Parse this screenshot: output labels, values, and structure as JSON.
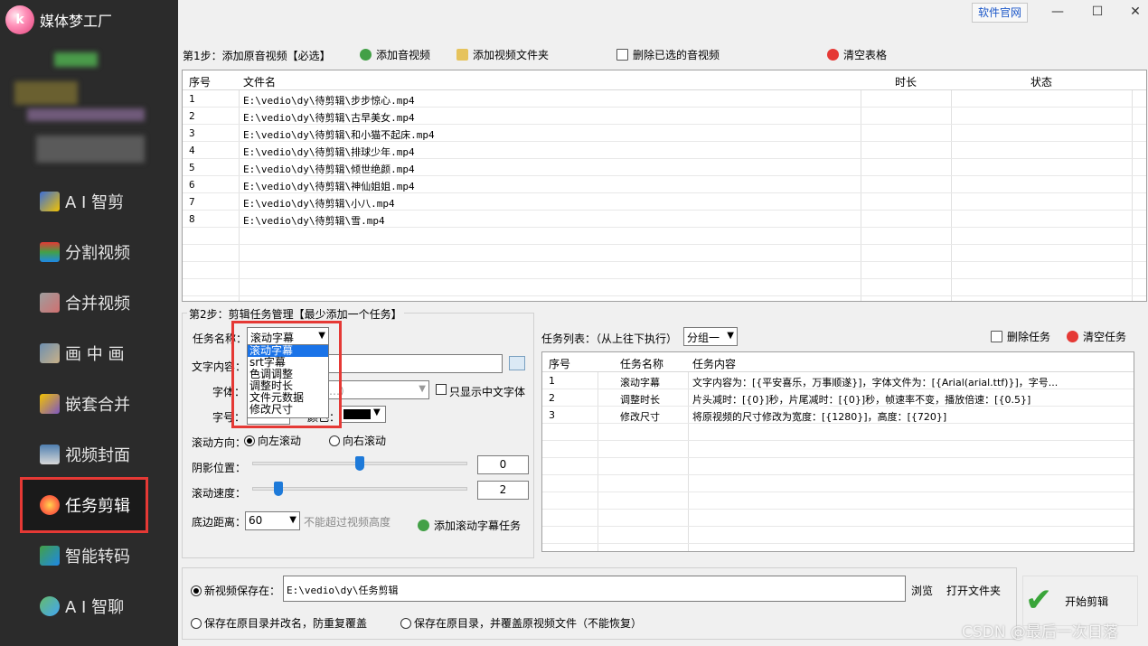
{
  "app": {
    "title": "媒体梦工厂",
    "logo_text": "k"
  },
  "sidebar": {
    "items": [
      {
        "label": "A I 智剪",
        "icon": "ai-cut-icon"
      },
      {
        "label": "分割视频",
        "icon": "split-video-icon"
      },
      {
        "label": "合并视频",
        "icon": "merge-video-icon"
      },
      {
        "label": "画 中 画",
        "icon": "picture-in-picture-icon"
      },
      {
        "label": "嵌套合并",
        "icon": "nested-merge-icon"
      },
      {
        "label": "视频封面",
        "icon": "video-cover-icon"
      },
      {
        "label": "任务剪辑",
        "icon": "task-edit-icon",
        "active": true
      },
      {
        "label": "智能转码",
        "icon": "smart-transcode-icon"
      },
      {
        "label": "A I 智聊",
        "icon": "ai-chat-icon"
      }
    ]
  },
  "topbar": {
    "site_link": "软件官网",
    "minimize": "—",
    "maximize": "☐",
    "close": "✕"
  },
  "step1": {
    "label": "第1步：添加原音视频【必选】",
    "add_av": "添加音视频",
    "add_folder": "添加视频文件夹",
    "delete_selected": "删除已选的音视频",
    "clear_table": "清空表格"
  },
  "file_table": {
    "headers": [
      "序号",
      "文件名",
      "时长",
      "状态"
    ],
    "rows": [
      [
        "1",
        "E:\\vedio\\dy\\待剪辑\\步步惊心.mp4"
      ],
      [
        "2",
        "E:\\vedio\\dy\\待剪辑\\古早美女.mp4"
      ],
      [
        "3",
        "E:\\vedio\\dy\\待剪辑\\和小猫不起床.mp4"
      ],
      [
        "4",
        "E:\\vedio\\dy\\待剪辑\\排球少年.mp4"
      ],
      [
        "5",
        "E:\\vedio\\dy\\待剪辑\\倾世绝颜.mp4"
      ],
      [
        "6",
        "E:\\vedio\\dy\\待剪辑\\神仙姐姐.mp4"
      ],
      [
        "7",
        "E:\\vedio\\dy\\待剪辑\\小八.mp4"
      ],
      [
        "8",
        "E:\\vedio\\dy\\待剪辑\\雪.mp4"
      ]
    ]
  },
  "step2": {
    "label": "第2步：剪辑任务管理【最少添加一个任务】",
    "task_name_label": "任务名称：",
    "task_name_value": "滚动字幕",
    "task_options": [
      "滚动字幕",
      "srt字幕",
      "色调调整",
      "调整时长",
      "文件元数据",
      "修改尺寸"
    ],
    "text_content_label": "文字内容：",
    "font_label": "字体：",
    "font_value": "…）",
    "only_chinese_label": "只显示中文字体",
    "size_label": "字号：",
    "color_label": "颜色：",
    "direction_label": "滚动方向：",
    "dir_left": "向左滚动",
    "dir_right": "向右滚动",
    "shadow_label": "阴影位置：",
    "shadow_value": "0",
    "speed_label": "滚动速度：",
    "speed_value": "2",
    "bottom_label": "底边距离：",
    "bottom_value": "60",
    "bottom_hint": "不能超过视频高度",
    "add_task": "添加滚动字幕任务"
  },
  "task_list": {
    "label": "任务列表：（从上往下执行）",
    "group_value": "分组一",
    "delete_task": "删除任务",
    "clear_tasks": "清空任务",
    "headers": [
      "序号",
      "任务名称",
      "任务内容"
    ],
    "rows": [
      [
        "1",
        "滚动字幕",
        "文字内容为：[{平安喜乐，万事顺遂}]，字体文件为：[{Arial(arial.ttf)}]，字号..."
      ],
      [
        "2",
        "调整时长",
        "片头减时：[{0}]秒，片尾减时：[{0}]秒，帧速率不变，播放倍速：[{0.5}]"
      ],
      [
        "3",
        "修改尺寸",
        "将原视频的尺寸修改为宽度：[{1280}]，高度：[{720}]"
      ]
    ]
  },
  "output": {
    "save_label": "新视频保存在：",
    "save_path": "E:\\vedio\\dy\\任务剪辑",
    "browse": "浏览",
    "open_folder": "打开文件夹",
    "option_rename": "保存在原目录并改名，防重复覆盖",
    "option_overwrite": "保存在原目录，并覆盖原视频文件（不能恢复）",
    "start": "开始剪辑"
  },
  "watermark": "CSDN @最后一次日落",
  "colors": {
    "sidebar_bg": "#2b2b2b",
    "highlight_red": "#e53935",
    "accent_blue": "#1a73e8"
  }
}
